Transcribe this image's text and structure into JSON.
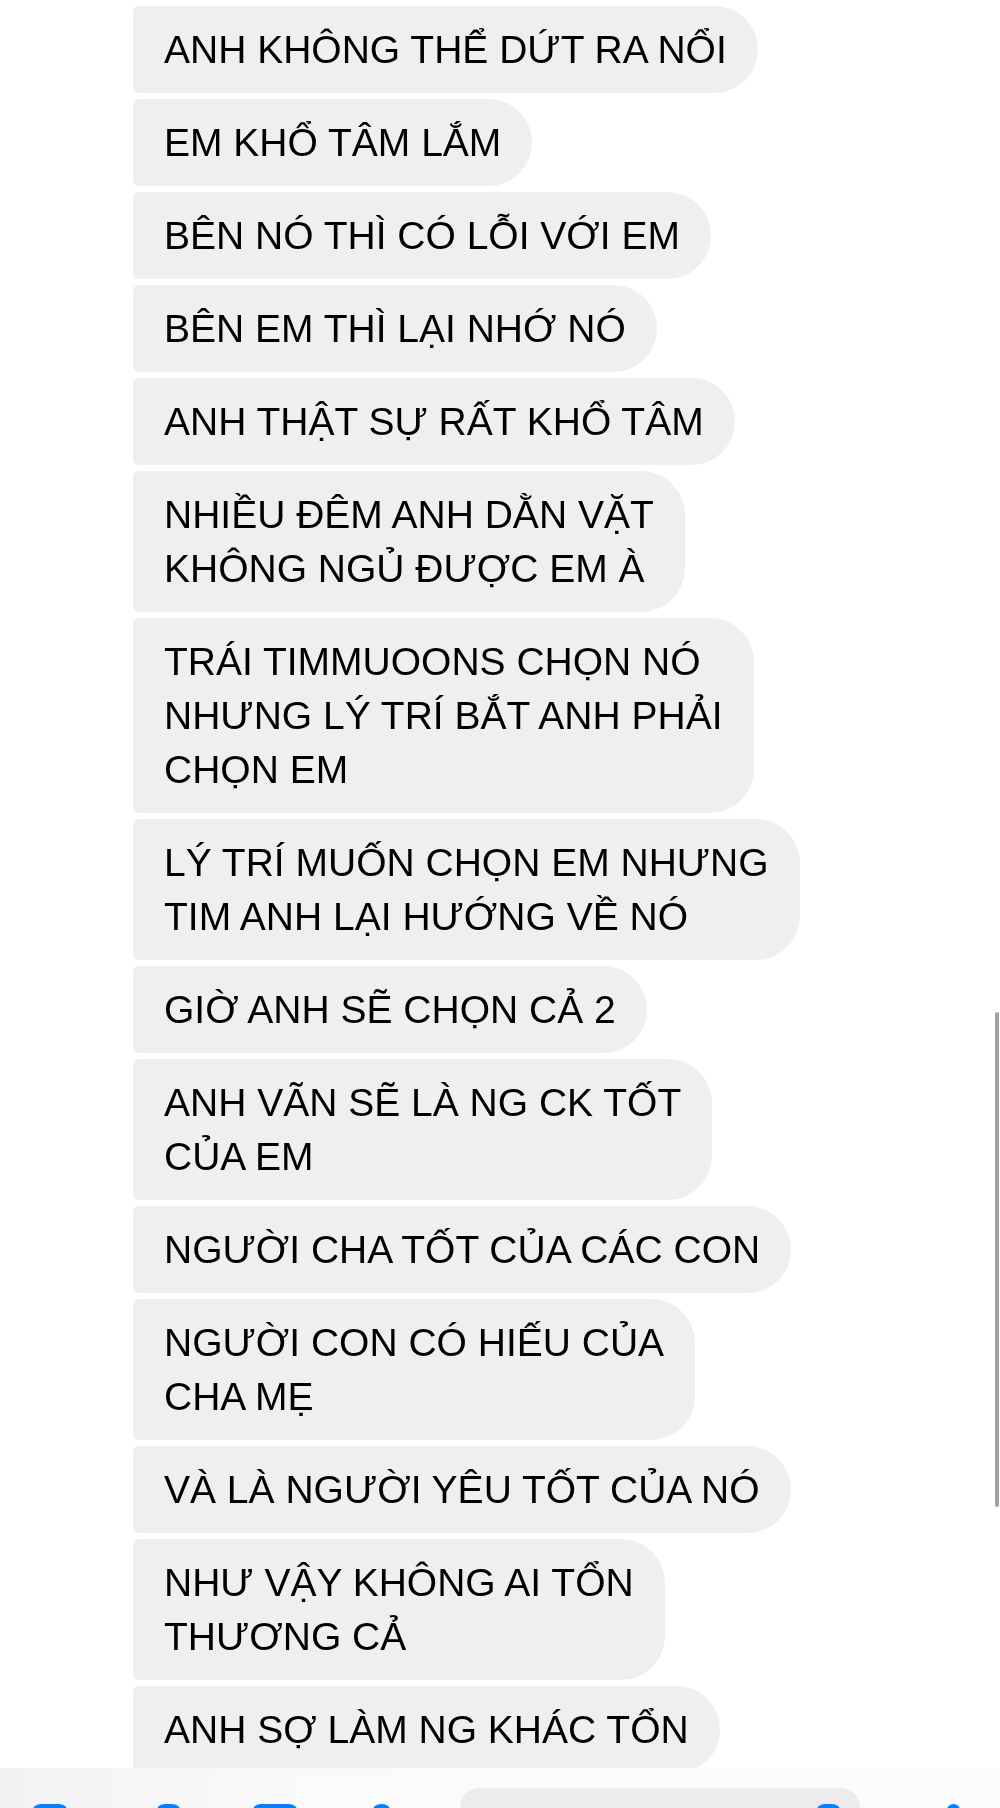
{
  "messages": [
    "ANH KHÔNG THỂ DỨT RA NỔI",
    "EM KHỔ TÂM LẮM",
    "BÊN NÓ THÌ CÓ LỖI VỚI EM",
    "BÊN EM THÌ LẠI NHỚ NÓ",
    "ANH THẬT SỰ RẤT KHỔ TÂM",
    "NHIỀU ĐÊM ANH DẰN VẶT\nKHÔNG NGỦ ĐƯỢC EM À",
    "TRÁI TIMMUOONS CHỌN NÓ\nNHƯNG LÝ TRÍ BẮT ANH PHẢI\nCHỌN EM",
    "LÝ TRÍ MUỐN CHỌN EM NHƯNG\nTIM ANH LẠI HƯỚNG VỀ NÓ",
    "GIỜ ANH SẼ CHỌN CẢ 2",
    "ANH VÃN SẼ LÀ NG CK TỐT\nCỦA EM",
    "NGƯỜI CHA TỐT CỦA CÁC CON",
    "NGƯỜI CON CÓ HIẾU CỦA\nCHA MẸ",
    "VÀ LÀ NGƯỜI YÊU TỐT CỦA NÓ",
    "NHƯ VẬY KHÔNG AI TỔN\nTHƯƠNG CẢ",
    "ANH SỢ LÀM NG KHÁC TỔN"
  ]
}
